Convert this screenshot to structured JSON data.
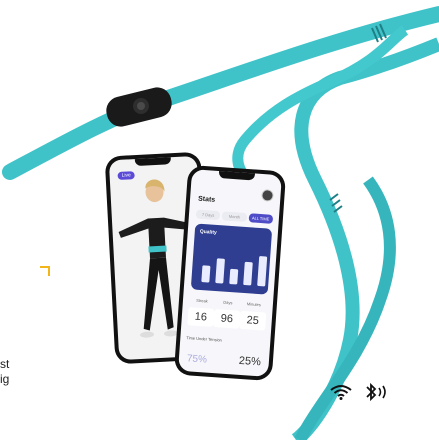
{
  "left_caption": {
    "line1": "st",
    "line2": "ig"
  },
  "accent_colors": {
    "band": "#3fc3c8",
    "band_dark": "#2a9fa6",
    "bracket": "#f2b51a",
    "card": "#2f3e91"
  },
  "left_phone": {
    "tag": "Live"
  },
  "right_phone": {
    "title": "Stats",
    "tabs": [
      {
        "label": "7 Days"
      },
      {
        "label": "Month"
      },
      {
        "label": "ALL TIME",
        "active": true
      }
    ],
    "card": {
      "title": "Quality"
    },
    "bars": [
      0.42,
      0.62,
      0.38,
      0.58,
      0.75
    ],
    "stats": [
      {
        "label": "Streak",
        "value": "16"
      },
      {
        "label": "Days",
        "value": "96"
      },
      {
        "label": "Minutes",
        "value": "25"
      }
    ],
    "timer_label": "Time Under Tension",
    "percent_left": "75%",
    "percent_right": "25%"
  },
  "status_icons": {
    "wifi": "wifi-icon",
    "bluetooth": "bluetooth-icon"
  }
}
